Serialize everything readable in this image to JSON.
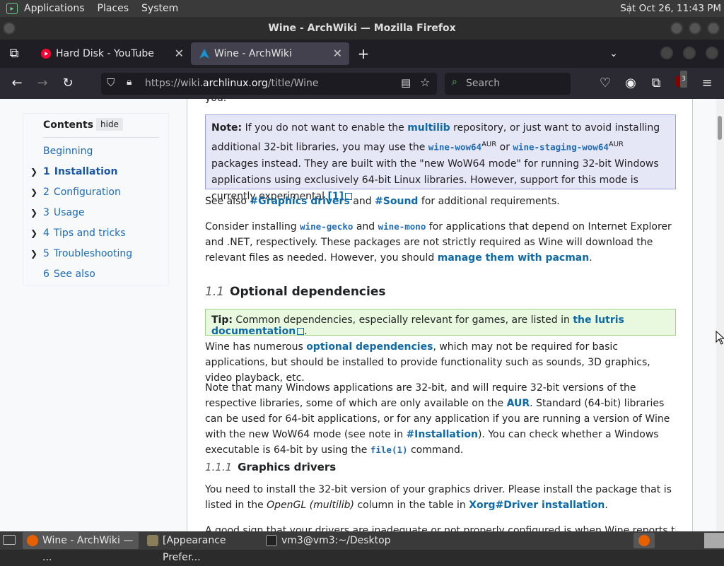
{
  "panel": {
    "menus": [
      "Applications",
      "Places",
      "System"
    ],
    "clock": "Sat Oct 26, 11:43 PM"
  },
  "window": {
    "title": "Wine - ArchWiki — Mozilla Firefox"
  },
  "tabs": [
    {
      "label": "Hard Disk - YouTube",
      "favicon": "youtube-icon"
    },
    {
      "label": "Wine - ArchWiki",
      "favicon": "archlinux-icon"
    }
  ],
  "nav": {
    "url_prefix": "https://wiki.",
    "url_domain": "archlinux.org",
    "url_path": "/title/Wine",
    "search_placeholder": "Search",
    "ublock_badge": "3"
  },
  "toc": {
    "title": "Contents",
    "hide": "hide",
    "items": [
      {
        "num": "",
        "label": "Beginning"
      },
      {
        "num": "1",
        "label": "Installation"
      },
      {
        "num": "2",
        "label": "Configuration"
      },
      {
        "num": "3",
        "label": "Usage"
      },
      {
        "num": "4",
        "label": "Tips and tricks"
      },
      {
        "num": "5",
        "label": "Troubleshooting"
      },
      {
        "num": "6",
        "label": "See also"
      }
    ]
  },
  "article": {
    "partial_top": "you.",
    "note": {
      "label": "Note:",
      "t1": " If you do not want to enable the ",
      "multilib": "multilib",
      "t2": " repository, or just want to avoid installing additional 32-bit libraries, you may use the ",
      "pkg1": "wine-wow64",
      "aur": "AUR",
      "t3": " or ",
      "pkg2": "wine-staging-wow64",
      "t4": " packages instead. They are built with the \"new WoW64 mode\" for running 32-bit Windows applications using exclusively 64-bit Linux libraries. However, support for this mode is currently experimental.",
      "ref": "[1]"
    },
    "see_also": {
      "t1": "See also ",
      "l1": "#Graphics drivers",
      "t2": " and ",
      "l2": "#Sound",
      "t3": " for additional requirements."
    },
    "consider": {
      "t1": "Consider installing ",
      "p1": "wine-gecko",
      "t2": " and ",
      "p2": "wine-mono",
      "t3": " for applications that depend on Internet Explorer and .NET, respectively. These packages are not strictly required as Wine will download the relevant files as needed. However, you should ",
      "l1": "manage them with pacman",
      "t4": "."
    },
    "h_optional": {
      "sec": "1.1",
      "title": "Optional dependencies"
    },
    "tip": {
      "label": "Tip:",
      "t1": " Common dependencies, especially relevant for games, are listed in ",
      "l1": "the lutris documentation",
      "t2": "."
    },
    "numerous": {
      "t1": "Wine has numerous ",
      "l1": "optional dependencies",
      "t2": ", which may not be required for basic applications, but should be installed to provide functionality such as sounds, 3D graphics, video playback, etc."
    },
    "note32": {
      "t1": "Note that many Windows applications are 32-bit, and will require 32-bit versions of the respective libraries, some of which are only available on the ",
      "l1": "AUR",
      "t2": ". Standard (64-bit) libraries can be used for 64-bit applications, or for any application if you are running a version of Wine with the new WoW64 mode (see note in ",
      "l2": "#Installation",
      "t3": "). You can check whether a Windows executable is 64-bit by using the ",
      "c1": "file(1)",
      "t4": " command."
    },
    "h_graphics": {
      "sec": "1.1.1",
      "title": "Graphics drivers"
    },
    "install32": {
      "t1": "You need to install the 32-bit version of your graphics driver. Please install the package that is listed in the ",
      "i1": "OpenGL (multilib)",
      "t2": " column in the table in ",
      "l1": "Xorg#Driver installation",
      "t3": "."
    },
    "partial_bottom": "A good sign that your drivers are inadequate or not properly configured is when Wine reports the following"
  },
  "taskbar": {
    "tasks": [
      "Wine - ArchWiki — ...",
      "[Appearance Prefer...",
      "vm3@vm3:~/Desktop"
    ]
  },
  "colors": {
    "link": "#0e69a8",
    "note_bg": "#e5e7f7",
    "tip_bg": "#e8f9e0",
    "panel": "#3a3a3a"
  }
}
